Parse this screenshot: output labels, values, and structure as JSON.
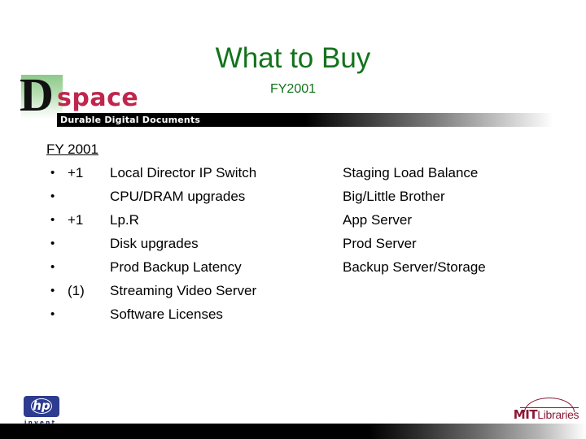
{
  "slide": {
    "title": "What to Buy",
    "subtitle": "FY2001",
    "title_color": "#12731b"
  },
  "logo": {
    "letter": "D",
    "wordmark": "space",
    "wordmark_color": "#c0264c",
    "tagline": "Durable Digital Documents"
  },
  "content": {
    "heading": "FY 2001",
    "bullets": [
      {
        "marker": "•",
        "qty": "+1",
        "text": "Local Director IP Switch"
      },
      {
        "marker": "•",
        "qty": "",
        "text": "CPU/DRAM upgrades"
      },
      {
        "marker": "•",
        "qty": "+1",
        "text": "Lp.R"
      },
      {
        "marker": "•",
        "qty": "",
        "text": "Disk upgrades"
      },
      {
        "marker": "•",
        "qty": "",
        "text": "Prod Backup Latency"
      },
      {
        "marker": "•",
        "qty": "(1)",
        "text": "Streaming Video Server"
      },
      {
        "marker": "•",
        "qty": "",
        "text": "Software Licenses"
      }
    ],
    "right_column": [
      "Staging Load Balance",
      "Big/Little Brother",
      "App Server",
      "Prod Server",
      "Backup Server/Storage"
    ]
  },
  "footer": {
    "hp": {
      "letters": "hp",
      "tagline": "invent",
      "badge_color": "#2d3c8f"
    },
    "mit": {
      "mit": "MIT",
      "libraries": "Libraries",
      "color": "#8a1a37"
    }
  }
}
